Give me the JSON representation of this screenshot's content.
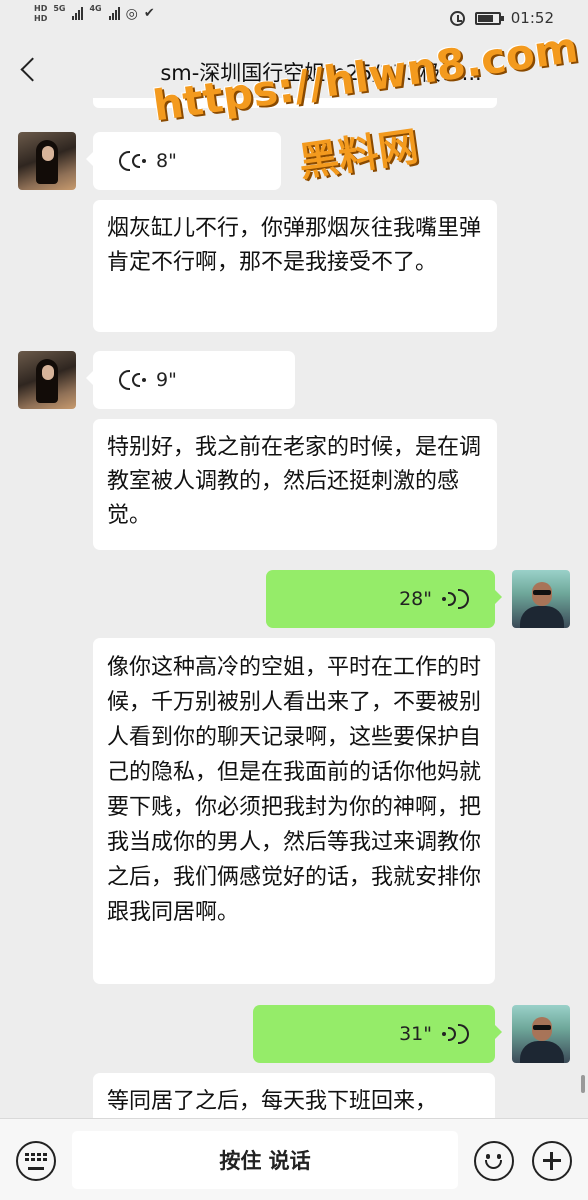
{
  "status_bar": {
    "hd_top": "HD",
    "hd_bottom": "HD",
    "network": "5G",
    "network2": "4G",
    "time": "01:52"
  },
  "header": {
    "title": "sm-深圳国行空姐m25/173极？..."
  },
  "watermark": {
    "url": "https://hlwn8.com",
    "text": "黑料网"
  },
  "messages": [
    {
      "side": "in",
      "type": "voice",
      "duration": "8\""
    },
    {
      "side": "in",
      "type": "text",
      "text": "烟灰缸儿不行，你弹那烟灰往我嘴里弹肯定不行啊，那不是我接受不了。"
    },
    {
      "side": "in",
      "type": "voice",
      "duration": "9\""
    },
    {
      "side": "in",
      "type": "text",
      "text": "特别好，我之前在老家的时候，是在调教室被人调教的，然后还挺刺激的感觉。"
    },
    {
      "side": "out",
      "type": "voice",
      "duration": "28\""
    },
    {
      "side": "in",
      "type": "text",
      "text": "像你这种高冷的空姐，平时在工作的时候，千万别被别人看出来了，不要被别人看到你的聊天记录啊，这些要保护自己的隐私，但是在我面前的话你他妈就要下贱，你必须把我封为你的神啊，把我当成你的男人，然后等我过来调教你之后，我们俩感觉好的话，我就安排你跟我同居啊。"
    },
    {
      "side": "out",
      "type": "voice",
      "duration": "31\""
    },
    {
      "side": "in",
      "type": "text",
      "text": "等同居了之后，每天我下班回来，"
    }
  ],
  "input_bar": {
    "hold_to_talk": "按住 说话"
  },
  "icons": {
    "back": "back-arrow-icon",
    "keyboard": "keyboard-icon",
    "emoji": "emoji-icon",
    "plus": "plus-icon",
    "voice": "voice-wave-icon"
  }
}
